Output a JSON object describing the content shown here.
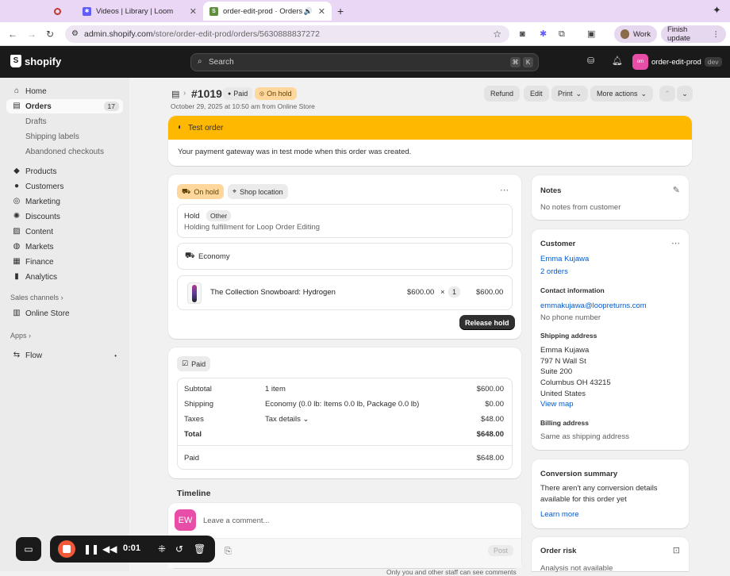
{
  "browser": {
    "tabs": [
      {
        "label": ""
      },
      {
        "label": "Videos | Library | Loom"
      },
      {
        "label": "order-edit-prod · Orders"
      }
    ],
    "new_tab": "+",
    "url_host": "admin.shopify.com",
    "url_path": "/store/order-edit-prod/orders/5630888837272",
    "profile": "Work",
    "finish_update": "Finish update"
  },
  "topbar": {
    "brand": "shopify",
    "search_placeholder": "Search",
    "kbd1": "⌘",
    "kbd2": "K",
    "store_name": "order-edit-prod",
    "store_avatar": "om",
    "store_badge": "dev"
  },
  "sidebar": {
    "items": [
      {
        "label": "Home"
      },
      {
        "label": "Orders",
        "badge": "17"
      },
      {
        "label": "Drafts"
      },
      {
        "label": "Shipping labels"
      },
      {
        "label": "Abandoned checkouts"
      },
      {
        "label": "Products"
      },
      {
        "label": "Customers"
      },
      {
        "label": "Marketing"
      },
      {
        "label": "Discounts"
      },
      {
        "label": "Content"
      },
      {
        "label": "Markets"
      },
      {
        "label": "Finance"
      },
      {
        "label": "Analytics"
      }
    ],
    "sales_channels": "Sales channels",
    "online_store": "Online Store",
    "apps": "Apps",
    "flow": "Flow"
  },
  "order": {
    "number": "#1019",
    "paid_badge": "Paid",
    "hold_badge": "On hold",
    "meta": "October 29, 2025 at 10:50 am from Online Store",
    "actions": {
      "refund": "Refund",
      "edit": "Edit",
      "print": "Print",
      "more": "More actions"
    }
  },
  "test_banner": {
    "title": "Test order",
    "body": "Your payment gateway was in test mode when this order was created."
  },
  "fulfillment": {
    "status": "On hold",
    "location": "Shop location",
    "hold_label": "Hold",
    "hold_reason": "Other",
    "hold_note": "Holding fulfillment for Loop Order Editing",
    "shipping_method": "Economy",
    "product_name": "The Collection Snowboard: Hydrogen",
    "unit_price": "$600.00",
    "times": "×",
    "qty": "1",
    "line_total": "$600.00",
    "release_button": "Release hold"
  },
  "payment": {
    "status": "Paid",
    "rows": [
      {
        "label": "Subtotal",
        "desc": "1 item",
        "amount": "$600.00"
      },
      {
        "label": "Shipping",
        "desc": "Economy (0.0 lb: Items 0.0 lb, Package 0.0 lb)",
        "amount": "$0.00"
      },
      {
        "label": "Taxes",
        "desc": "Tax details",
        "amount": "$48.00"
      },
      {
        "label": "Total",
        "desc": "",
        "amount": "$648.00"
      }
    ],
    "paid_label": "Paid",
    "paid_amount": "$648.00"
  },
  "timeline": {
    "title": "Timeline",
    "avatar": "EW",
    "placeholder": "Leave a comment...",
    "post": "Post",
    "footer": "Only you and other staff can see comments"
  },
  "notes": {
    "title": "Notes",
    "body": "No notes from customer"
  },
  "customer": {
    "title": "Customer",
    "name": "Emma Kujawa",
    "orders": "2 orders",
    "contact_title": "Contact information",
    "email": "emmakujawa@loopreturns.com",
    "phone": "No phone number",
    "shipping_title": "Shipping address",
    "address": [
      "Emma Kujawa",
      "797 N Wall St",
      "Suite 200",
      "Columbus OH 43215",
      "United States"
    ],
    "view_map": "View map",
    "billing_title": "Billing address",
    "billing": "Same as shipping address"
  },
  "conversion": {
    "title": "Conversion summary",
    "body1": "There aren't any conversion details",
    "body2": "available for this order yet",
    "learn": "Learn more"
  },
  "risk": {
    "title": "Order risk",
    "body": "Analysis not available"
  },
  "loom": {
    "time": "0:01"
  },
  "colors": {
    "accent_yellow": "#ffb800",
    "hold_bg": "#ffd79d",
    "link": "#005bd3",
    "topbar": "#1a1a1a"
  }
}
